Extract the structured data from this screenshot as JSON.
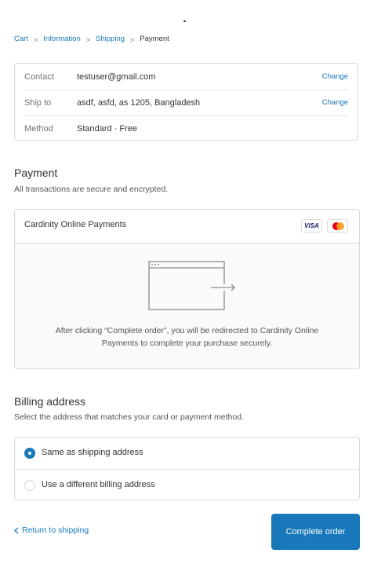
{
  "breadcrumb": {
    "cart": "Cart",
    "information": "Information",
    "shipping": "Shipping",
    "payment": "Payment",
    "separator": ">"
  },
  "review": {
    "contact": {
      "label": "Contact",
      "value": "testuser@gmail.com",
      "action": "Change"
    },
    "ship_to": {
      "label": "Ship to",
      "value": "asdf, asfd, as 1205, Bangladesh",
      "action": "Change"
    },
    "method": {
      "label": "Method",
      "value": "Standard · Free"
    }
  },
  "payment": {
    "title": "Payment",
    "subtitle": "All transactions are secure and encrypted.",
    "gateway_name": "Cardinity Online Payments",
    "card_visa": "VISA",
    "redirect_message": "After clicking “Complete order”, you will be redirected to Cardinity Online Payments to complete your purchase securely."
  },
  "billing": {
    "title": "Billing address",
    "subtitle": "Select the address that matches your card or payment method.",
    "options": [
      {
        "label": "Same as shipping address",
        "selected": true
      },
      {
        "label": "Use a different billing address",
        "selected": false
      }
    ]
  },
  "footer": {
    "return_label": "Return to shipping",
    "complete_label": "Complete order"
  },
  "colors": {
    "accent": "#1878b9",
    "border": "#d9d9d9",
    "muted_text": "#737373"
  }
}
